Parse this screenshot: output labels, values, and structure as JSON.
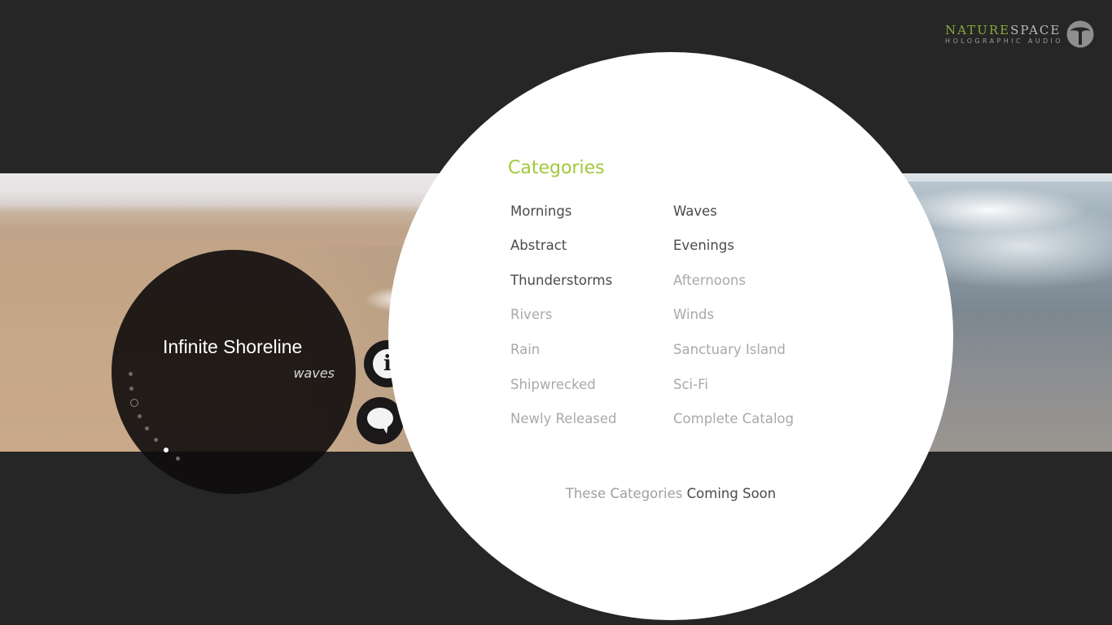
{
  "logo": {
    "name_part1": "NATURE",
    "name_part2": "SPACE",
    "tagline": "HOLOGRAPHIC AUDIO",
    "icon": "tree-logo-icon",
    "colors": {
      "accent": "#8aa83a",
      "secondary": "#b9b9b9"
    }
  },
  "now_playing": {
    "title": "Infinite Shoreline",
    "category": "waves"
  },
  "buttons": {
    "info_icon": "info-icon",
    "info_glyph": "i",
    "chat_icon": "speech-bubble-icon"
  },
  "categories": {
    "heading": "Categories",
    "heading_color": "#a2c83c",
    "items": [
      {
        "label": "Mornings",
        "available": true
      },
      {
        "label": "Waves",
        "available": true
      },
      {
        "label": "Abstract",
        "available": true
      },
      {
        "label": "Evenings",
        "available": true
      },
      {
        "label": "Thunderstorms",
        "available": true
      },
      {
        "label": "Afternoons",
        "available": false
      },
      {
        "label": "Rivers",
        "available": false
      },
      {
        "label": "Winds",
        "available": false
      },
      {
        "label": "Rain",
        "available": false
      },
      {
        "label": "Sanctuary Island",
        "available": false
      },
      {
        "label": "Shipwrecked",
        "available": false
      },
      {
        "label": "Sci-Fi",
        "available": false
      },
      {
        "label": "Newly Released",
        "available": false
      },
      {
        "label": "Complete Catalog",
        "available": false
      }
    ],
    "note_prefix": "These Categories",
    "note_suffix": "Coming Soon"
  }
}
